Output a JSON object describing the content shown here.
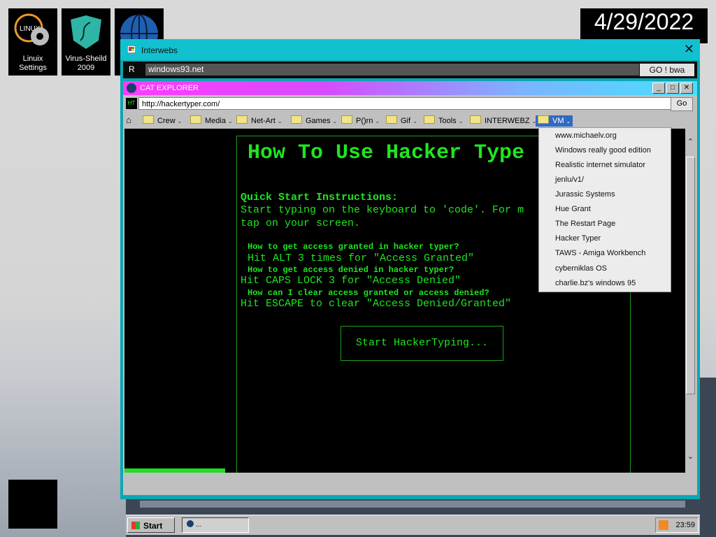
{
  "desktop": {
    "icons": [
      {
        "label_line1": "Linuix",
        "label_line2": "Settings",
        "icon": "gear-icon"
      },
      {
        "label_line1": "Virus-Sheild",
        "label_line2": "2009",
        "icon": "shield-icon"
      },
      {
        "label_line1": "",
        "label_line2": "",
        "icon": "globe-icon"
      }
    ],
    "clock_date": "4/29/2022"
  },
  "interwebs": {
    "title": "Interwebs",
    "close": "✕",
    "reload": "R",
    "url": "windows93.net",
    "go": "GO ! bwa"
  },
  "cat_explorer": {
    "title": "CAT EXPLORER",
    "address": "http://hackertyper.com/",
    "go": "Go",
    "favorites": [
      "Crew",
      "Media",
      "Net-Art",
      "Games",
      "P()rn",
      "Gif",
      "Tools",
      "INTERWEBZ",
      "VM"
    ],
    "vm_menu": [
      "www.michaelv.org",
      "Windows really good edition",
      "Realistic internet simulator",
      "jenlu/v1/",
      "Jurassic Systems",
      "Hue Grant",
      "The Restart Page",
      "Hacker Typer",
      "TAWS - Amiga Workbench",
      "cyberniklas OS",
      "charlie.bz's windows 95"
    ]
  },
  "page": {
    "heading": "How To Use Hacker Type",
    "quick_start": "Quick Start Instructions:",
    "line1": "Start typing on the keyboard to 'code'. For m",
    "line2": "tap on your screen.",
    "q1": "How to get access granted in hacker typer?",
    "a1": "Hit ALT 3 times for \"Access Granted\"",
    "q2": "How to get access denied in hacker typer?",
    "a2": "Hit CAPS LOCK 3 for \"Access Denied\"",
    "q3": "How can I clear access granted or access denied?",
    "a3": "Hit ESCAPE to clear \"Access Denied/Granted\"",
    "start_button": "Start HackerTyping..."
  },
  "taskbar": {
    "start": "Start",
    "task": "...",
    "time": "23:59"
  },
  "colors": {
    "terminal_green": "#1ee61e",
    "window_teal": "#12c1cf"
  }
}
